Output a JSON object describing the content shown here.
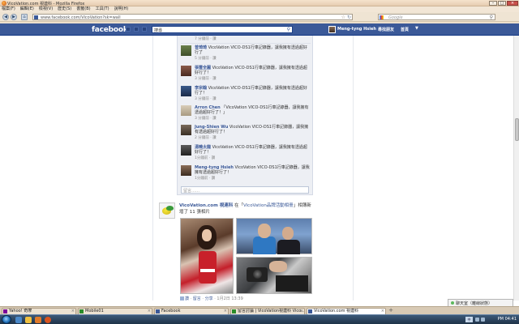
{
  "browser": {
    "title": "VicoVation.com 視連科 - Mozilla Firefox",
    "menu": [
      "檔案(F)",
      "編輯(E)",
      "檢視(V)",
      "歷史(S)",
      "書籤(B)",
      "工具(T)",
      "說明(H)"
    ],
    "url": "www.facebook.com/VicoVation?sk=wall",
    "search_placeholder": "Google",
    "tabs": [
      {
        "label": "Yahoo! 奇摩",
        "icon_color": "#7b0099"
      },
      {
        "label": "Mobile01",
        "icon_color": "#2a8c2a"
      },
      {
        "label": "Facebook",
        "icon_color": "#3b5998"
      },
      {
        "label": "留言討論 | VicoVation視連科 Vico...",
        "icon_color": "#2a8c2a"
      },
      {
        "label": "VicoVation.com 視連科",
        "icon_color": "#3b5998"
      }
    ],
    "new_tab": "+"
  },
  "facebook": {
    "logo": "facebook",
    "search_value": "搜尋",
    "user_name": "Meng-tyng Hsieh",
    "friends_link": "尋找朋友",
    "home_link": "首頁",
    "account_arrow": "▼"
  },
  "comments": {
    "first_meta": "7 分鐘前 · 讚",
    "items": [
      {
        "name": "曾琦琦",
        "text": "VicoVation VICO-DS1行車記錄器，讓我擁有透過超好行了",
        "meta": "5 分鐘前 · 讚",
        "avatar_color": "#6a7f4a"
      },
      {
        "name": "張豐全圓",
        "text": "VicoVation VICO-DS1行車記錄器，讓我擁有透過超好行了！",
        "meta": "3 分鐘前 · 讚",
        "avatar_color": "#8a5a4a"
      },
      {
        "name": "李宗翰",
        "text": "VicoVation VICO-DS1行車記錄器，讓我擁有透過超好行了！",
        "meta": "3 分鐘前 · 讚",
        "avatar_color": "#3a5a8a"
      },
      {
        "name": "Arron Chen",
        "text": "「VicoVation VICO-DS1行車記錄器，讓我擁有透過超好行了！」",
        "meta": "3 分鐘前 · 讚",
        "avatar_color": "#c9b9a0"
      },
      {
        "name": "Jung-Shien Wu",
        "text": "VicoVation VICO-DS1行車記錄器，讓我擁有透過超好行了！",
        "meta": "2 分鐘前 · 讚",
        "avatar_color": "#7a6a5a"
      },
      {
        "name": "湯曉太龍",
        "text": "VicoVation VICO-DS1行車記錄器，讓我擁有透過超好行了！",
        "meta": "1分鐘前 · 讚",
        "avatar_color": "#4a4a4a"
      },
      {
        "name": "Meng-tyng Hsieh",
        "text": "VicoVation VICO-DS1行車記錄器，讓我擁有透過超好行了！",
        "meta": "1分鐘前 · 讚",
        "avatar_color": "#5a3f2c"
      }
    ],
    "reply_placeholder": "留言……"
  },
  "post": {
    "page_name": "VicoVation.com 視連科",
    "action_text": "在「",
    "album_name": "VicoVation品牌活動相冊",
    "action_text2": "」相簿新增了 11 張相片",
    "actions": [
      "讚",
      "留言",
      "分享"
    ],
    "timestamp": "1月2日 13:39"
  },
  "chat": {
    "label": "聊天室（離線狀態）",
    "status_color": "#5cb85c"
  },
  "taskbar": {
    "clock": "PM 04:41",
    "lang": "中"
  }
}
